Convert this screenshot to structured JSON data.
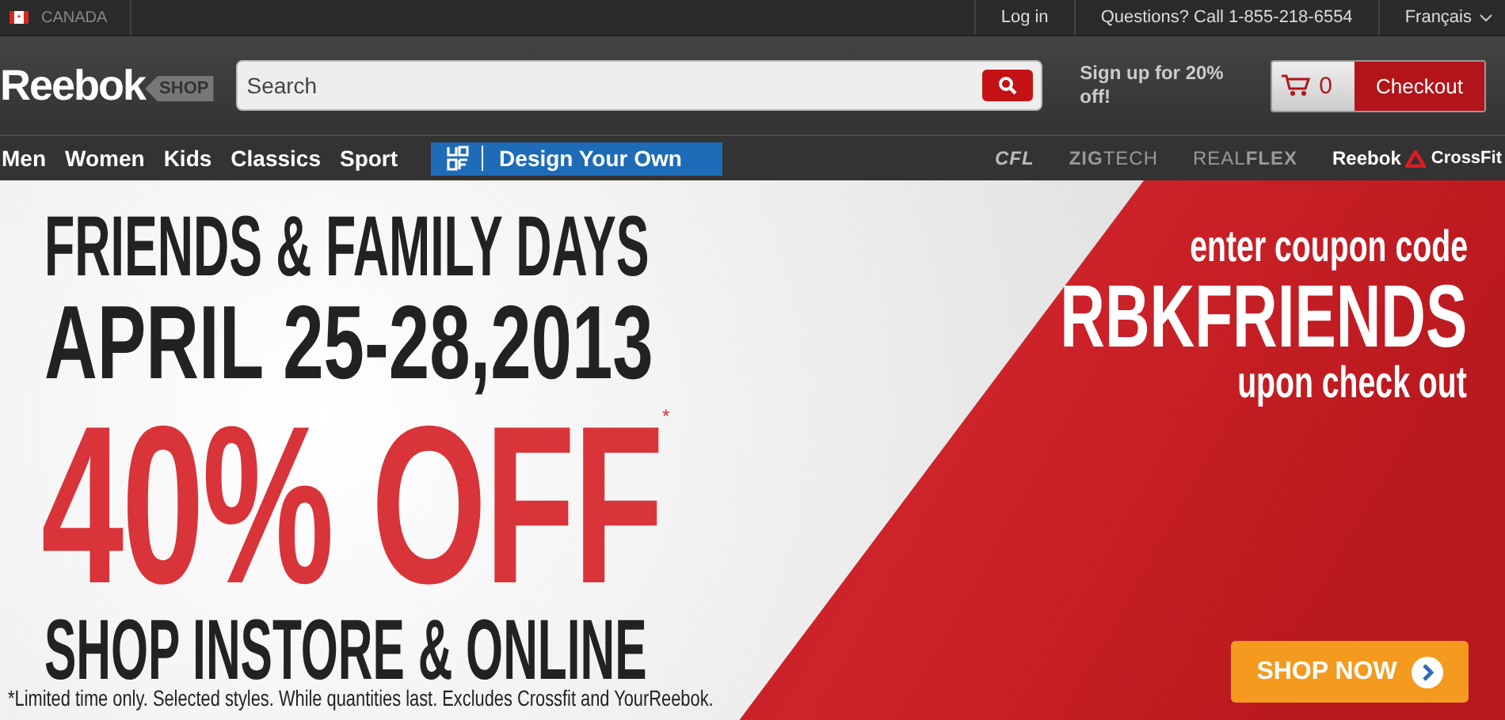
{
  "top_bar": {
    "country": "CANADA",
    "links": [
      "Log in",
      "Questions? Call 1-855-218-6554"
    ],
    "language": "Français"
  },
  "header": {
    "logo": "Reebok",
    "logo_tag": "SHOP",
    "search": {
      "placeholder": "Search"
    },
    "signup": "Sign up for 20% off!",
    "cart_count": "0",
    "checkout": "Checkout"
  },
  "nav": {
    "items": [
      "Men",
      "Women",
      "Kids",
      "Classics",
      "Sport"
    ],
    "feature": "Design Your Own",
    "brands": [
      "CFL",
      "**ZIG**TECH",
      "REAL**FLEX**",
      "Reebok",
      "CrossFit"
    ]
  },
  "banner": {
    "headline": [
      "FRIENDS & FAMILY DAYS",
      "APRIL 25-28,2013"
    ],
    "offer": "40% OFF",
    "offer_mark": "*",
    "subline": "SHOP INSTORE & ONLINE",
    "footnote": "*Limited time only. Selected styles. While quantities last. Excludes Crossfit and YourReebok.",
    "coupon_intro": "enter coupon code",
    "coupon_code": "RBKFRIENDS",
    "coupon_outro": "upon check out",
    "cta": "SHOP NOW"
  }
}
